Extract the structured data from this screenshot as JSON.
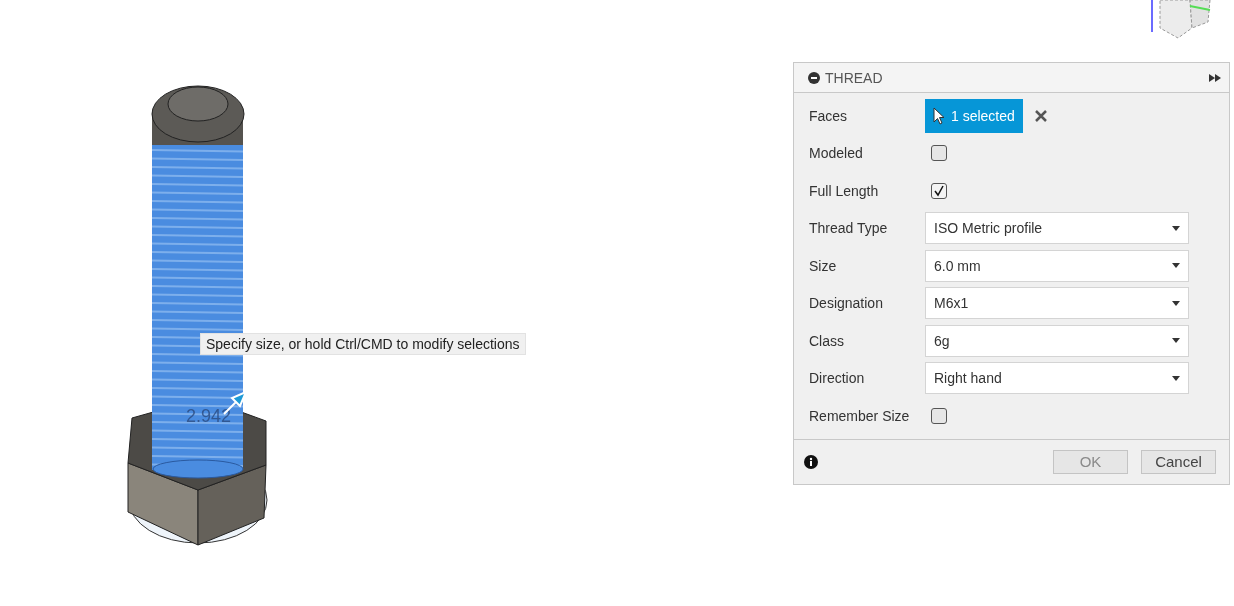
{
  "viewport": {
    "dimension": "2.942",
    "tooltip": "Specify size, or hold Ctrl/CMD to modify selections"
  },
  "dialog": {
    "title": "THREAD",
    "rows": [
      {
        "label": "Faces",
        "kind": "selection",
        "value": "1 selected"
      },
      {
        "label": "Modeled",
        "kind": "checkbox",
        "checked": false
      },
      {
        "label": "Full Length",
        "kind": "checkbox",
        "checked": true
      },
      {
        "label": "Thread Type",
        "kind": "dropdown",
        "value": "ISO Metric profile"
      },
      {
        "label": "Size",
        "kind": "dropdown",
        "value": "6.0 mm"
      },
      {
        "label": "Designation",
        "kind": "dropdown",
        "value": "M6x1"
      },
      {
        "label": "Class",
        "kind": "dropdown",
        "value": "6g"
      },
      {
        "label": "Direction",
        "kind": "dropdown",
        "value": "Right hand"
      },
      {
        "label": "Remember Size",
        "kind": "checkbox",
        "checked": false
      }
    ],
    "buttons": [
      {
        "label": "OK",
        "disabled": true
      },
      {
        "label": "Cancel",
        "disabled": false
      }
    ]
  }
}
